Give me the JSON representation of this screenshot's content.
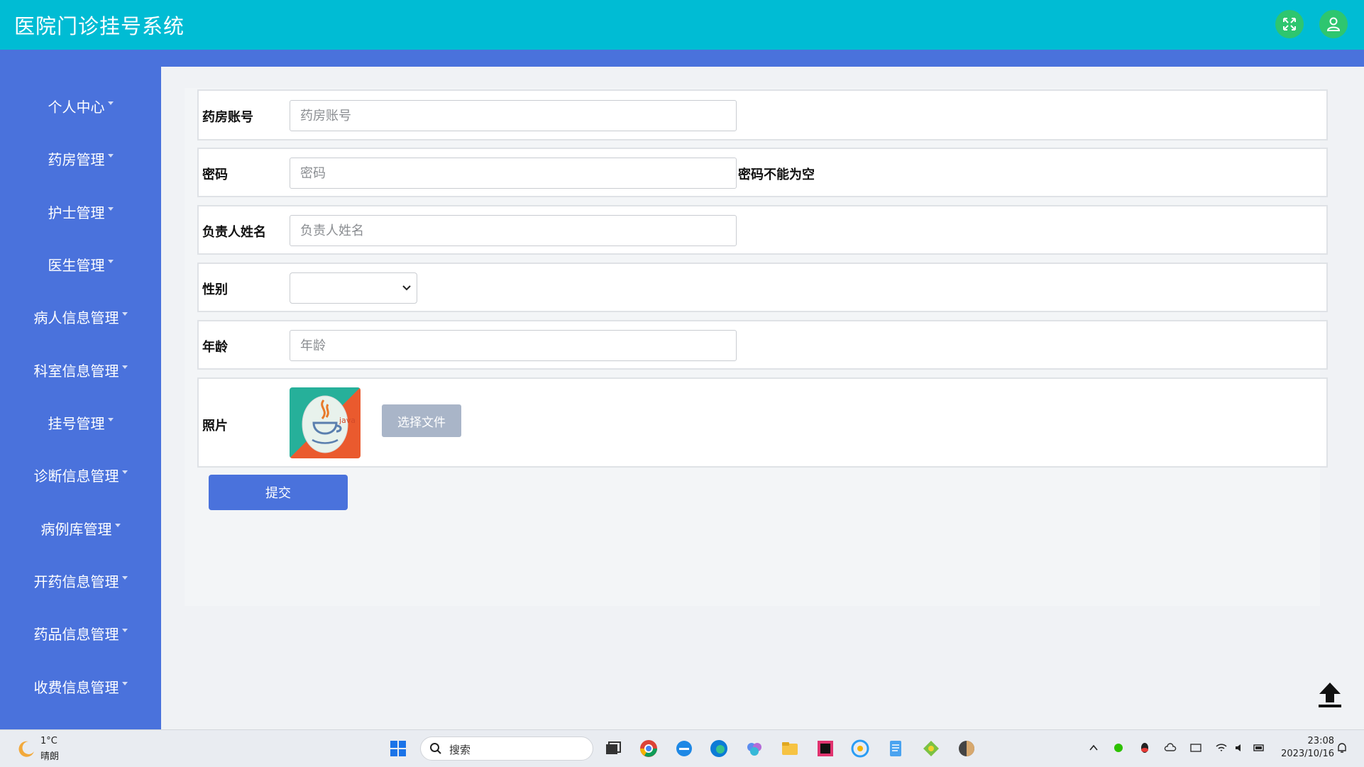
{
  "header": {
    "title": "医院门诊挂号系统",
    "accent_color": "#00bcd4",
    "icons": [
      "fullscreen-icon",
      "user-icon"
    ]
  },
  "sidebar": {
    "color": "#4a72dc",
    "items": [
      {
        "label": "个人中心"
      },
      {
        "label": "药房管理"
      },
      {
        "label": "护士管理"
      },
      {
        "label": "医生管理"
      },
      {
        "label": "病人信息管理"
      },
      {
        "label": "科室信息管理"
      },
      {
        "label": "挂号管理"
      },
      {
        "label": "诊断信息管理"
      },
      {
        "label": "病例库管理"
      },
      {
        "label": "开药信息管理"
      },
      {
        "label": "药品信息管理"
      },
      {
        "label": "收费信息管理"
      }
    ]
  },
  "form": {
    "account": {
      "label": "药房账号",
      "placeholder": "药房账号",
      "value": ""
    },
    "password": {
      "label": "密码",
      "placeholder": "密码",
      "value": "",
      "error": "密码不能为空"
    },
    "manager_name": {
      "label": "负责人姓名",
      "placeholder": "负责人姓名",
      "value": ""
    },
    "gender": {
      "label": "性别",
      "selected": ""
    },
    "age": {
      "label": "年龄",
      "placeholder": "年龄",
      "value": ""
    },
    "photo": {
      "label": "照片",
      "choose_file_label": "选择文件",
      "thumb_text": "java"
    },
    "submit_label": "提交"
  },
  "taskbar": {
    "weather_temp": "1°C",
    "weather_desc": "晴朗",
    "search_placeholder": "搜索",
    "time": "23:08",
    "date": "2023/10/16"
  }
}
